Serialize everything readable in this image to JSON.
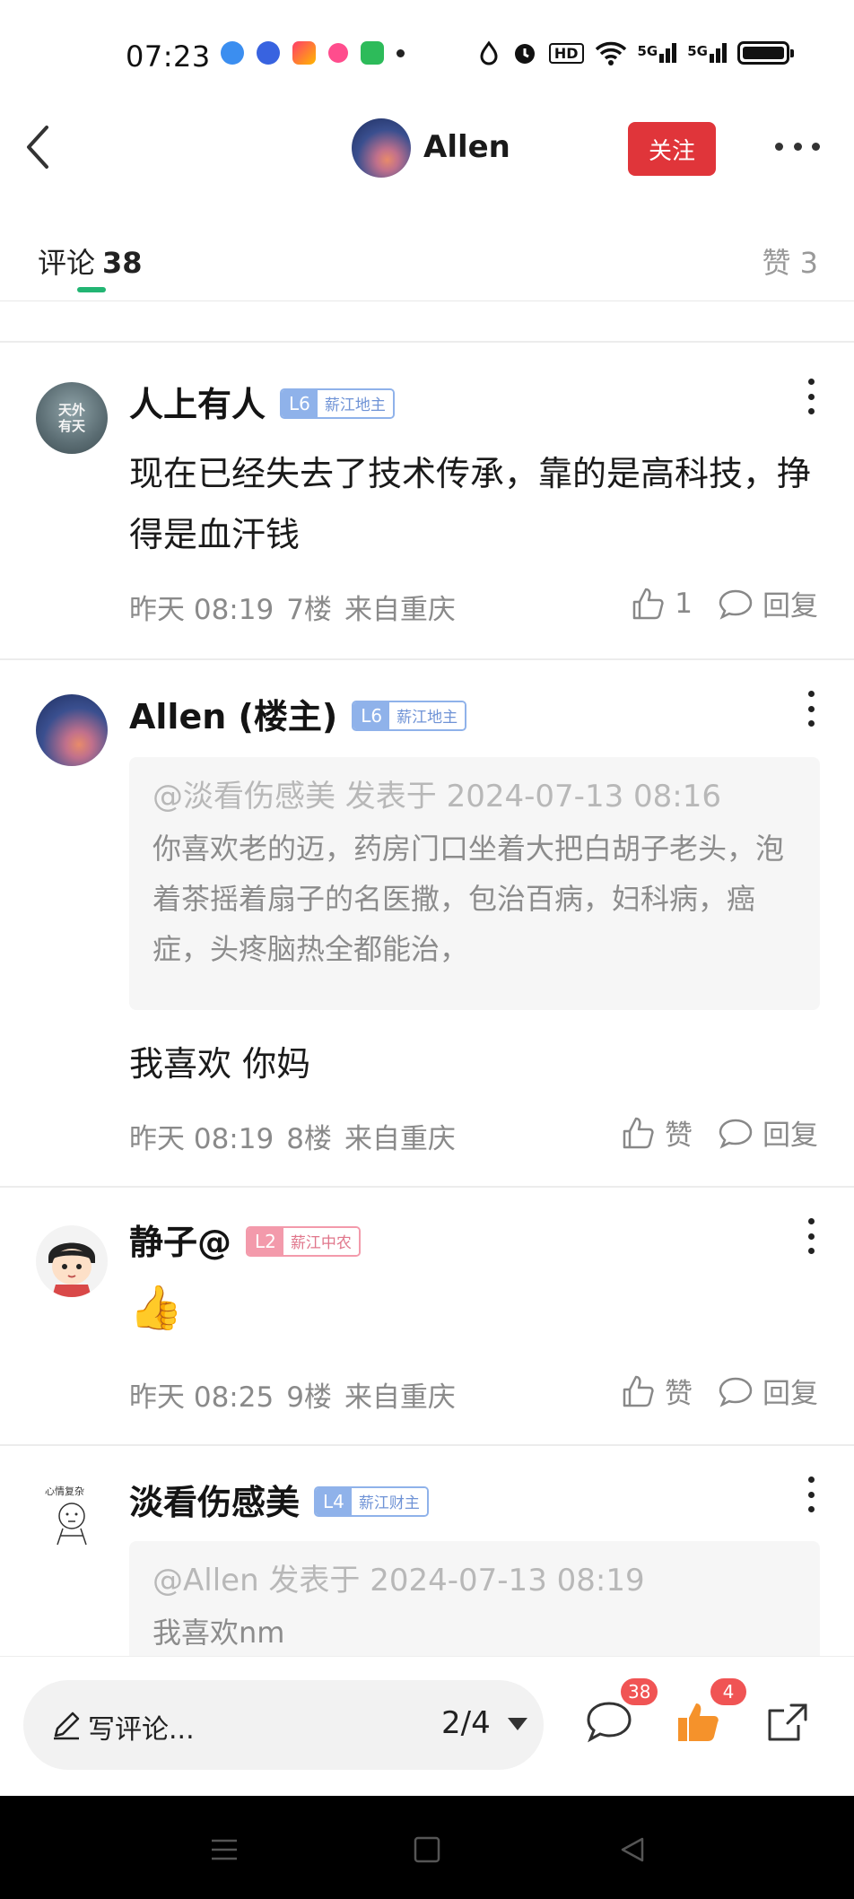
{
  "status_bar": {
    "time": "07:23",
    "hd_label": "HD",
    "net_labels": [
      "5G",
      "5G"
    ]
  },
  "header": {
    "user_name": "Allen",
    "follow_label": "关注",
    "back_icon": "chevron-left-icon",
    "more_icon": "more-horizontal-icon"
  },
  "tabs": {
    "comments_label": "评论",
    "comments_count": "38",
    "likes_label": "赞 3",
    "accent": "#22b573"
  },
  "comments": [
    {
      "name": "人上有人",
      "level": "L6",
      "title": "薪江地主",
      "badge_color": "blue",
      "text": "现在已经失去了技术传承，靠的是高科技，挣得是血汗钱",
      "time": "昨天 08:19",
      "floor": "7楼",
      "location": "来自重庆",
      "like_label": "1",
      "reply_label": "回复"
    },
    {
      "name": "Allen (楼主)",
      "level": "L6",
      "title": "薪江地主",
      "badge_color": "blue",
      "quote_head": "@淡看伤感美 发表于 2024-07-13 08:16",
      "quote_body": "你喜欢老的迈，药房门口坐着大把白胡子老头，泡着茶摇着扇子的名医撒，包治百病，妇科病，癌症，头疼脑热全都能治，",
      "text": "我喜欢 你妈",
      "time": "昨天 08:19",
      "floor": "8楼",
      "location": "来自重庆",
      "like_label": "赞",
      "reply_label": "回复"
    },
    {
      "name": "静子@",
      "level": "L2",
      "title": "薪江中农",
      "badge_color": "pink",
      "text": "👍",
      "time": "昨天 08:25",
      "floor": "9楼",
      "location": "来自重庆",
      "like_label": "赞",
      "reply_label": "回复"
    },
    {
      "name": "淡看伤感美",
      "level": "L4",
      "title": "薪江财主",
      "badge_color": "blue",
      "avatar_text": "心情复杂",
      "quote_head": "@Allen 发表于 2024-07-13 08:19",
      "quote_body": "我喜欢nm"
    }
  ],
  "avatar_text_1": "天外有天",
  "bottom_bar": {
    "input_placeholder": "写评论...",
    "pager": "2/4",
    "comment_count": "38",
    "like_count": "4",
    "badge_color": "#f05454",
    "like_color": "#f5922b"
  }
}
